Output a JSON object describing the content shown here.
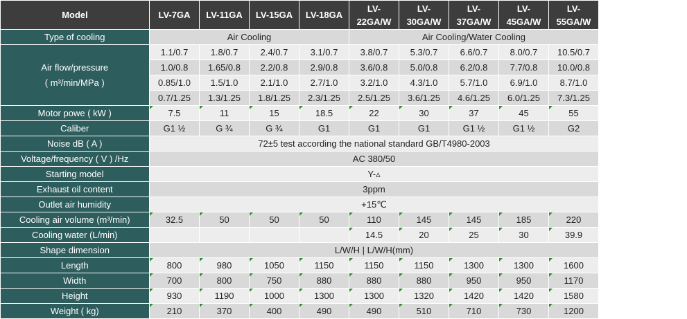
{
  "header": {
    "label": "Model",
    "models": [
      [
        "LV-7GA"
      ],
      [
        "LV-11GA"
      ],
      [
        "LV-15GA"
      ],
      [
        "LV-18GA"
      ],
      [
        "LV-",
        "22GA/W"
      ],
      [
        "LV-",
        "30GA/W"
      ],
      [
        "LV-",
        "37GA/W"
      ],
      [
        "LV-",
        "45GA/W"
      ],
      [
        "LV-",
        "55GA/W"
      ]
    ]
  },
  "rows": {
    "type_of_cooling": {
      "label": "Type of cooling",
      "air": "Air Cooling",
      "air_water": "Air Cooling/Water Cooling"
    },
    "air_flow": {
      "label_line1": "Air flow/pressure",
      "label_line2": "( m³/min/MPa )",
      "values": [
        [
          "1.1/0.7",
          "1.8/0.7",
          "2.4/0.7",
          "3.1/0.7",
          "3.8/0.7",
          "5.3/0.7",
          "6.6/0.7",
          "8.0/0.7",
          "10.5/0.7"
        ],
        [
          "1.0/0.8",
          "1.65/0.8",
          "2.2/0.8",
          "2.9/0.8",
          "3.6/0.8",
          "5.0/0.8",
          "6.2/0.8",
          "7.7/0.8",
          "10.0/0.8"
        ],
        [
          "0.85/1.0",
          "1.5/1.0",
          "2.1/1.0",
          "2.7/1.0",
          "3.2/1.0",
          "4.3/1.0",
          "5.7/1.0",
          "6.9/1.0",
          "8.7/1.0"
        ],
        [
          "0.7/1.25",
          "1.3/1.25",
          "1.8/1.25",
          "2.3/1.25",
          "2.5/1.25",
          "3.6/1.25",
          "4.6/1.25",
          "6.0/1.25",
          "7.3/1.25"
        ]
      ]
    },
    "motor_power": {
      "label": "Motor powe  ( kW )",
      "values": [
        "7.5",
        "11",
        "15",
        "18.5",
        "22",
        "30",
        "37",
        "45",
        "55"
      ]
    },
    "caliber": {
      "label": "Caliber",
      "values": [
        "G1 ½",
        "G ¾",
        "G ¾",
        "G1",
        "G1",
        "G1",
        "G1 ½",
        "G1 ½",
        "G2"
      ]
    },
    "noise": {
      "label": "Noise    dB ( A )",
      "value": "72±5 test according the national standard GB/T4980-2003"
    },
    "voltage": {
      "label": "Voltage/frequency   ( V ) /Hz",
      "value": "AC 380/50"
    },
    "starting_model": {
      "label": "Starting model",
      "value": "Y-▵"
    },
    "exhaust_oil": {
      "label": "Exhaust oil content",
      "value": "3ppm"
    },
    "outlet_humidity": {
      "label": "Outlet air humidity",
      "value": "+15℃"
    },
    "cooling_air_volume": {
      "label": "Cooling air volume (m³/min)",
      "values": [
        "32.5",
        "50",
        "50",
        "50",
        "110",
        "145",
        "145",
        "185",
        "220"
      ]
    },
    "cooling_water": {
      "label": "Cooling water  (L/min)",
      "values": [
        "",
        "",
        "",
        "",
        "14.5",
        "20",
        "25",
        "30",
        "39.9"
      ]
    },
    "shape_dimension": {
      "label": "Shape dimension",
      "value": "L/W/H  |   L/W/H(mm)"
    },
    "length": {
      "label": "Length",
      "values": [
        "800",
        "980",
        "1050",
        "1150",
        "1150",
        "1150",
        "1300",
        "1300",
        "1600"
      ]
    },
    "width": {
      "label": "Width",
      "values": [
        "700",
        "800",
        "750",
        "880",
        "880",
        "880",
        "950",
        "950",
        "1170"
      ]
    },
    "height": {
      "label": "Height",
      "values": [
        "930",
        "1190",
        "1000",
        "1300",
        "1300",
        "1320",
        "1420",
        "1420",
        "1580"
      ]
    },
    "weight": {
      "label": "Weight ( kg)",
      "values": [
        "210",
        "370",
        "400",
        "490",
        "490",
        "510",
        "710",
        "730",
        "1200"
      ]
    }
  },
  "colors": {
    "header_bg": "#3d3d3d",
    "label_bg": "#2e5d5d",
    "row_alt": "#d9d9d9",
    "row_plain": "#ededed",
    "marker": "#2e8b2e"
  }
}
